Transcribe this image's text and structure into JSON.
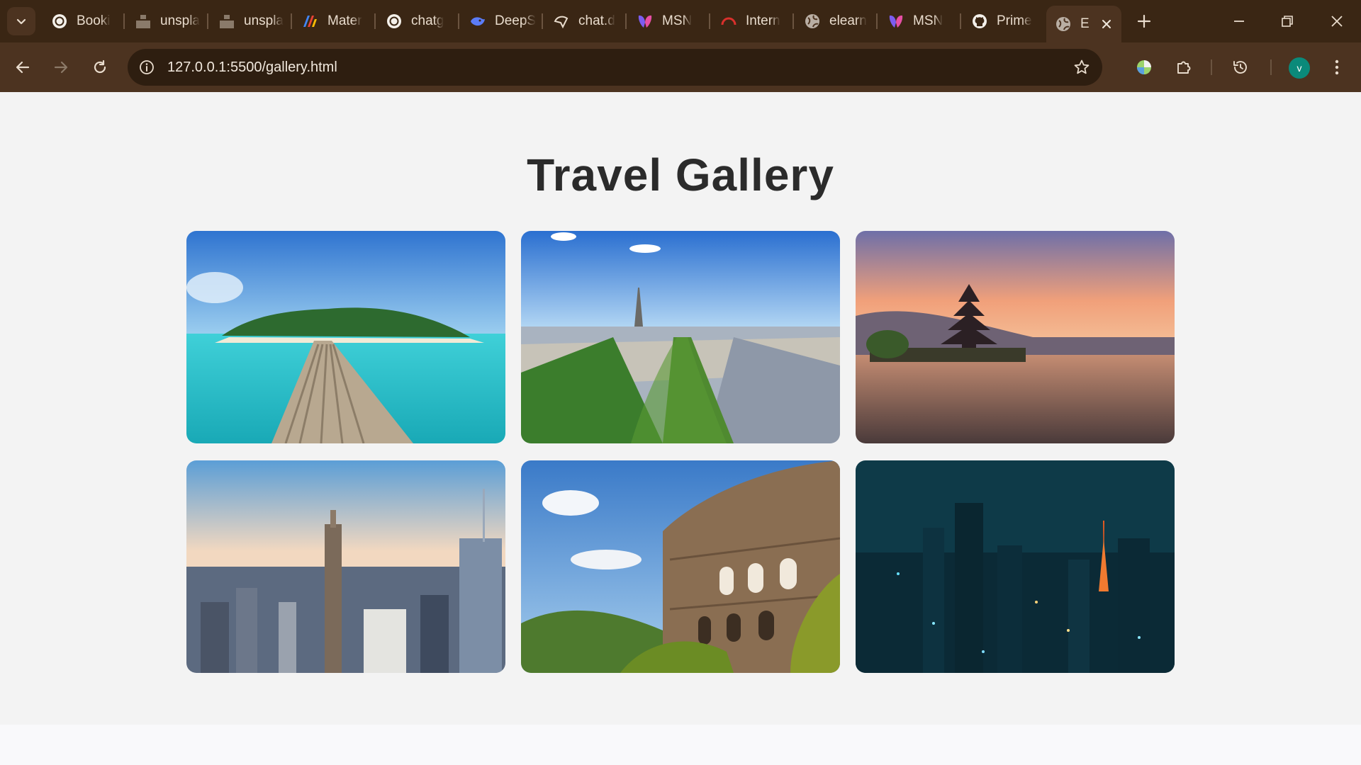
{
  "browser": {
    "tabs": [
      {
        "title": "Booki",
        "icon": "chatgpt-icon"
      },
      {
        "title": "unspla",
        "icon": "unsplash-icon"
      },
      {
        "title": "unspla",
        "icon": "unsplash-icon"
      },
      {
        "title": "Mater",
        "icon": "material-icon"
      },
      {
        "title": "chatg",
        "icon": "chatgpt-icon"
      },
      {
        "title": "DeepS",
        "icon": "deepseek-icon"
      },
      {
        "title": "chat.d",
        "icon": "chat-icon"
      },
      {
        "title": "MSN",
        "icon": "msn-icon"
      },
      {
        "title": "Intern",
        "icon": "speed-icon"
      },
      {
        "title": "elearn",
        "icon": "globe-icon"
      },
      {
        "title": "MSN",
        "icon": "msn-icon"
      },
      {
        "title": "Prime",
        "icon": "github-icon"
      },
      {
        "title": "E",
        "icon": "globe-icon",
        "active": true
      }
    ],
    "url": "127.0.0.1:5500/gallery.html",
    "profile_initial": "v"
  },
  "page": {
    "title": "Travel Gallery",
    "photos": [
      {
        "subject": "tropical-island-pier"
      },
      {
        "subject": "paris-eiffel-tower"
      },
      {
        "subject": "bali-temple-sunset"
      },
      {
        "subject": "new-york-skyline"
      },
      {
        "subject": "rome-colosseum"
      },
      {
        "subject": "tokyo-night-tower"
      }
    ]
  },
  "colors": {
    "chrome_dark": "#3a2614",
    "chrome_toolbar": "#4c3320",
    "page_bg": "#f3f3f3",
    "title_text": "#2b2b2b"
  }
}
